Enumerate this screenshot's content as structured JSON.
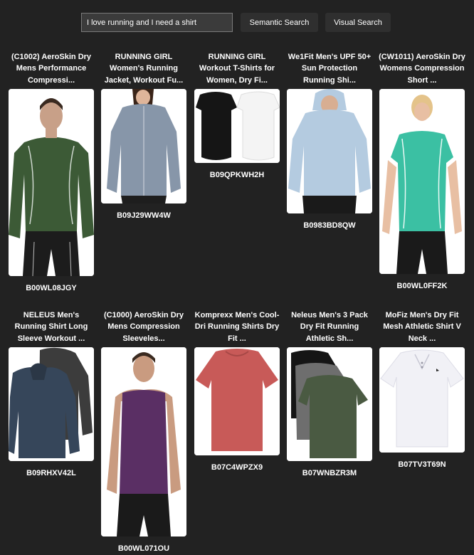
{
  "search": {
    "value": "I love running and I need a shirt",
    "semantic_label": "Semantic Search",
    "visual_label": "Visual Search"
  },
  "products": [
    {
      "title": "(C1002) AeroSkin Dry Mens Performance Compressi...",
      "code": "B00WL08JGY",
      "image": "man-long-sleeve-green-shirt"
    },
    {
      "title": "RUNNING GIRL Women's Running Jacket, Workout Fu...",
      "code": "B09J29WW4W",
      "image": "woman-grey-zip-jacket"
    },
    {
      "title": "RUNNING GIRL Workout T-Shirts for Women, Dry Fi...",
      "code": "B09QPKWH2H",
      "image": "black-and-white-tshirts"
    },
    {
      "title": "We1Fit Men's UPF 50+ Sun Protection Running Shi...",
      "code": "B0983BD8QW",
      "image": "man-light-blue-hoodie"
    },
    {
      "title": "(CW1011) AeroSkin Dry Womens Compression Short ...",
      "code": "B00WL0FF2K",
      "image": "woman-teal-tshirt"
    },
    {
      "title": "NELEUS Men's Running Shirt Long Sleeve Workout ...",
      "code": "B09RHXV42L",
      "image": "dark-hooded-long-sleeve-shirts"
    },
    {
      "title": "(C1000) AeroSkin Dry Mens Compression Sleeveles...",
      "code": "B00WL071OU",
      "image": "man-purple-tank-top"
    },
    {
      "title": "Komprexx Men's Cool-Dri Running Shirts Dry Fit ...",
      "code": "B07C4WPZX9",
      "image": "red-heather-tshirt"
    },
    {
      "title": "Neleus Men's 3 Pack Dry Fit Running Athletic Sh...",
      "code": "B07WNBZR3M",
      "image": "three-pack-tshirts"
    },
    {
      "title": "MoFiz Men's Dry Fit Mesh Athletic Shirt V Neck ...",
      "code": "B07TV3T69N",
      "image": "white-henley-shirt"
    }
  ],
  "colors": {
    "background": "#222222",
    "input": "#3b3b3b",
    "button": "#2f2f2f",
    "text": "#ffffff"
  }
}
